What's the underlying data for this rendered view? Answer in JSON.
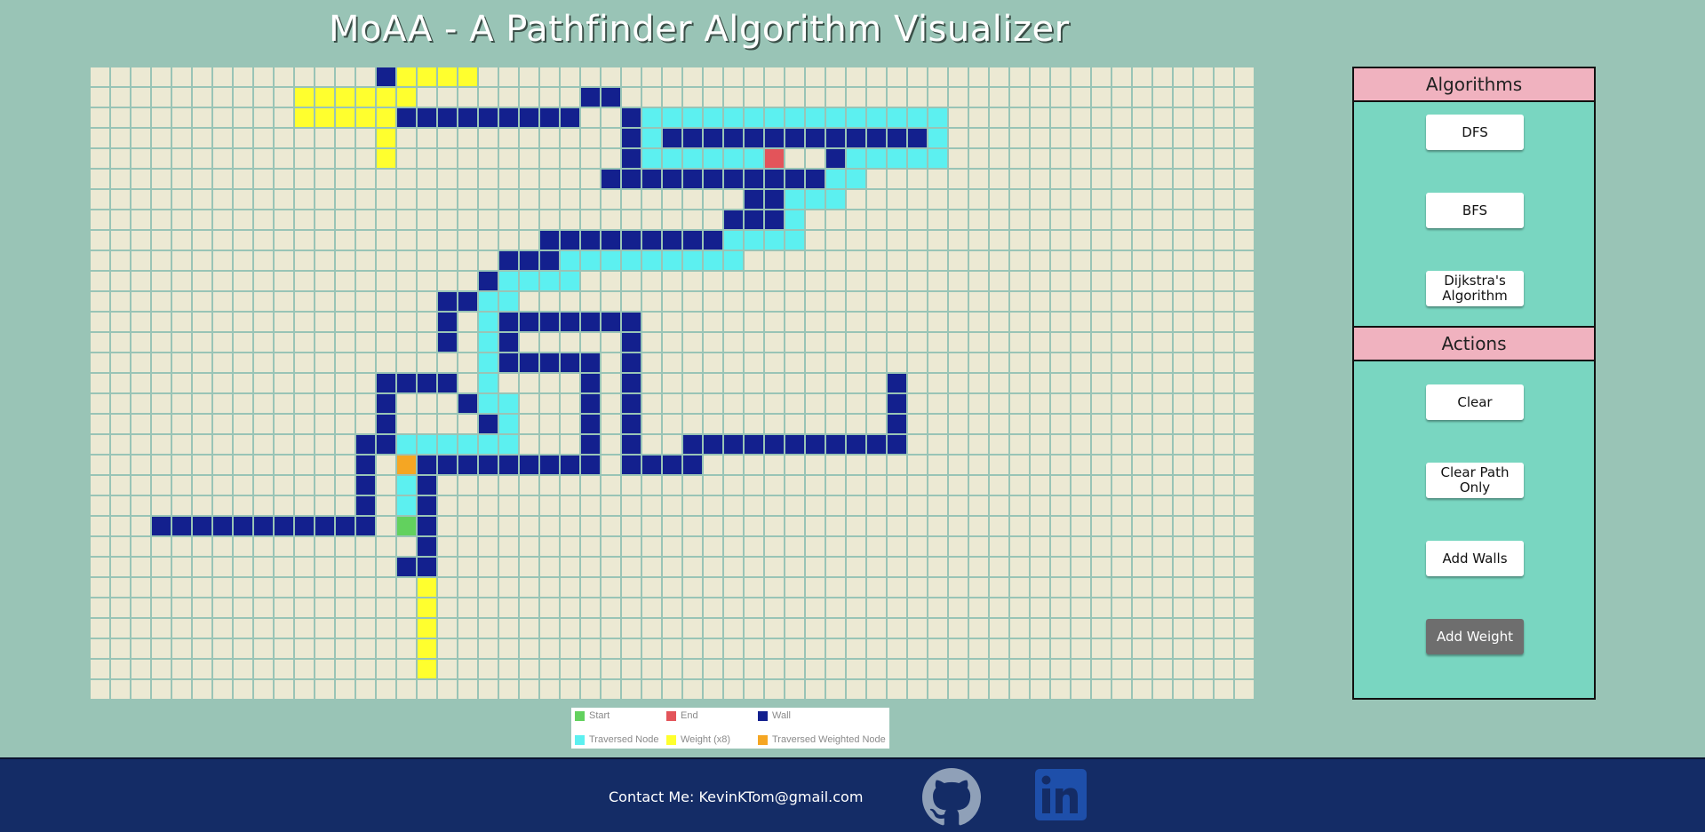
{
  "app": {
    "title": "MoAA - A Pathfinder Algorithm Visualizer"
  },
  "grid": {
    "rows": [
      ".....................................................",
      "...........................",
      "...........................................................",
      "...........................................................",
      "...........................................................",
      "...........................................................",
      "...........................................................",
      "...........................................................",
      "...........................................................",
      "...........................................................",
      "...........................................................",
      "...........................................................",
      "...........................................................",
      "...........................................................",
      "...........................................................",
      "...........................................................",
      "...........................................................",
      "...........................................................",
      "...........................................................",
      "...........................................................",
      "...........................................................",
      "...........................................................",
      "...........................................................",
      "...........................................................",
      "...........................................................",
      "...........................................................",
      "...........................................................",
      "...........................................................",
      "...........................................................",
      "...........................................................",
      "..........................................................."
    ],
    "cells": [
      [
        0,
        14,
        "w"
      ],
      [
        0,
        15,
        "y"
      ],
      [
        0,
        16,
        "y"
      ],
      [
        0,
        17,
        "y"
      ],
      [
        0,
        18,
        "y"
      ],
      [
        1,
        10,
        "y"
      ],
      [
        1,
        11,
        "y"
      ],
      [
        1,
        12,
        "y"
      ],
      [
        1,
        13,
        "y"
      ],
      [
        1,
        14,
        "y"
      ],
      [
        1,
        15,
        "y"
      ],
      [
        1,
        24,
        "w"
      ],
      [
        1,
        25,
        "w"
      ],
      [
        2,
        10,
        "y"
      ],
      [
        2,
        11,
        "y"
      ],
      [
        2,
        12,
        "y"
      ],
      [
        2,
        13,
        "y"
      ],
      [
        2,
        14,
        "y"
      ],
      [
        2,
        15,
        "w"
      ],
      [
        2,
        16,
        "w"
      ],
      [
        2,
        17,
        "w"
      ],
      [
        2,
        18,
        "w"
      ],
      [
        2,
        19,
        "w"
      ],
      [
        2,
        20,
        "w"
      ],
      [
        2,
        21,
        "w"
      ],
      [
        2,
        22,
        "w"
      ],
      [
        2,
        23,
        "w"
      ],
      [
        2,
        26,
        "w"
      ],
      [
        2,
        27,
        "t"
      ],
      [
        2,
        28,
        "t"
      ],
      [
        2,
        29,
        "t"
      ],
      [
        2,
        30,
        "t"
      ],
      [
        2,
        31,
        "t"
      ],
      [
        2,
        32,
        "t"
      ],
      [
        2,
        33,
        "t"
      ],
      [
        2,
        34,
        "t"
      ],
      [
        2,
        35,
        "t"
      ],
      [
        2,
        36,
        "t"
      ],
      [
        2,
        37,
        "t"
      ],
      [
        2,
        38,
        "t"
      ],
      [
        2,
        39,
        "t"
      ],
      [
        2,
        40,
        "t"
      ],
      [
        2,
        41,
        "t"
      ],
      [
        3,
        14,
        "y"
      ],
      [
        3,
        26,
        "w"
      ],
      [
        3,
        27,
        "t"
      ],
      [
        3,
        28,
        "w"
      ],
      [
        3,
        29,
        "w"
      ],
      [
        3,
        30,
        "w"
      ],
      [
        3,
        31,
        "w"
      ],
      [
        3,
        32,
        "w"
      ],
      [
        3,
        33,
        "w"
      ],
      [
        3,
        34,
        "w"
      ],
      [
        3,
        35,
        "w"
      ],
      [
        3,
        36,
        "w"
      ],
      [
        3,
        37,
        "w"
      ],
      [
        3,
        38,
        "w"
      ],
      [
        3,
        39,
        "w"
      ],
      [
        3,
        40,
        "w"
      ],
      [
        3,
        41,
        "t"
      ],
      [
        4,
        14,
        "y"
      ],
      [
        4,
        26,
        "w"
      ],
      [
        4,
        27,
        "t"
      ],
      [
        4,
        28,
        "t"
      ],
      [
        4,
        29,
        "t"
      ],
      [
        4,
        30,
        "t"
      ],
      [
        4,
        31,
        "t"
      ],
      [
        4,
        32,
        "t"
      ],
      [
        4,
        33,
        "e"
      ],
      [
        4,
        36,
        "w"
      ],
      [
        4,
        37,
        "t"
      ],
      [
        4,
        38,
        "t"
      ],
      [
        4,
        39,
        "t"
      ],
      [
        4,
        40,
        "t"
      ],
      [
        4,
        41,
        "t"
      ],
      [
        5,
        25,
        "w"
      ],
      [
        5,
        26,
        "w"
      ],
      [
        5,
        27,
        "w"
      ],
      [
        5,
        28,
        "w"
      ],
      [
        5,
        29,
        "w"
      ],
      [
        5,
        30,
        "w"
      ],
      [
        5,
        31,
        "w"
      ],
      [
        5,
        32,
        "w"
      ],
      [
        5,
        33,
        "w"
      ],
      [
        5,
        34,
        "w"
      ],
      [
        5,
        35,
        "w"
      ],
      [
        5,
        36,
        "t"
      ],
      [
        5,
        37,
        "t"
      ],
      [
        6,
        32,
        "w"
      ],
      [
        6,
        33,
        "w"
      ],
      [
        6,
        34,
        "t"
      ],
      [
        6,
        35,
        "t"
      ],
      [
        6,
        36,
        "t"
      ],
      [
        7,
        31,
        "w"
      ],
      [
        7,
        32,
        "w"
      ],
      [
        7,
        33,
        "w"
      ],
      [
        7,
        34,
        "t"
      ],
      [
        8,
        22,
        "w"
      ],
      [
        8,
        23,
        "w"
      ],
      [
        8,
        24,
        "w"
      ],
      [
        8,
        25,
        "w"
      ],
      [
        8,
        26,
        "w"
      ],
      [
        8,
        27,
        "w"
      ],
      [
        8,
        28,
        "w"
      ],
      [
        8,
        29,
        "w"
      ],
      [
        8,
        30,
        "w"
      ],
      [
        8,
        31,
        "t"
      ],
      [
        8,
        32,
        "t"
      ],
      [
        8,
        33,
        "t"
      ],
      [
        8,
        34,
        "t"
      ],
      [
        9,
        20,
        "w"
      ],
      [
        9,
        21,
        "w"
      ],
      [
        9,
        22,
        "w"
      ],
      [
        9,
        23,
        "t"
      ],
      [
        9,
        24,
        "t"
      ],
      [
        9,
        25,
        "t"
      ],
      [
        9,
        26,
        "t"
      ],
      [
        9,
        27,
        "t"
      ],
      [
        9,
        28,
        "t"
      ],
      [
        9,
        29,
        "t"
      ],
      [
        9,
        30,
        "t"
      ],
      [
        9,
        31,
        "t"
      ],
      [
        10,
        19,
        "w"
      ],
      [
        10,
        20,
        "t"
      ],
      [
        10,
        21,
        "t"
      ],
      [
        10,
        22,
        "t"
      ],
      [
        10,
        23,
        "t"
      ],
      [
        11,
        17,
        "w"
      ],
      [
        11,
        18,
        "w"
      ],
      [
        11,
        19,
        "t"
      ],
      [
        11,
        20,
        "t"
      ],
      [
        12,
        17,
        "w"
      ],
      [
        12,
        19,
        "t"
      ],
      [
        12,
        20,
        "w"
      ],
      [
        12,
        21,
        "w"
      ],
      [
        12,
        22,
        "w"
      ],
      [
        12,
        23,
        "w"
      ],
      [
        12,
        24,
        "w"
      ],
      [
        12,
        25,
        "w"
      ],
      [
        12,
        26,
        "w"
      ],
      [
        13,
        17,
        "w"
      ],
      [
        13,
        19,
        "t"
      ],
      [
        13,
        20,
        "w"
      ],
      [
        13,
        26,
        "w"
      ],
      [
        14,
        19,
        "t"
      ],
      [
        14,
        20,
        "w"
      ],
      [
        14,
        21,
        "w"
      ],
      [
        14,
        22,
        "w"
      ],
      [
        14,
        23,
        "w"
      ],
      [
        14,
        24,
        "w"
      ],
      [
        14,
        26,
        "w"
      ],
      [
        15,
        14,
        "w"
      ],
      [
        15,
        15,
        "w"
      ],
      [
        15,
        16,
        "w"
      ],
      [
        15,
        17,
        "w"
      ],
      [
        15,
        19,
        "t"
      ],
      [
        15,
        24,
        "w"
      ],
      [
        15,
        26,
        "w"
      ],
      [
        15,
        39,
        "w"
      ],
      [
        16,
        14,
        "w"
      ],
      [
        16,
        18,
        "w"
      ],
      [
        16,
        19,
        "t"
      ],
      [
        16,
        20,
        "t"
      ],
      [
        16,
        24,
        "w"
      ],
      [
        16,
        26,
        "w"
      ],
      [
        16,
        39,
        "w"
      ],
      [
        17,
        14,
        "w"
      ],
      [
        17,
        19,
        "w"
      ],
      [
        17,
        20,
        "t"
      ],
      [
        17,
        24,
        "w"
      ],
      [
        17,
        26,
        "w"
      ],
      [
        17,
        39,
        "w"
      ],
      [
        18,
        13,
        "w"
      ],
      [
        18,
        14,
        "w"
      ],
      [
        18,
        15,
        "t"
      ],
      [
        18,
        16,
        "t"
      ],
      [
        18,
        17,
        "t"
      ],
      [
        18,
        18,
        "t"
      ],
      [
        18,
        19,
        "t"
      ],
      [
        18,
        20,
        "t"
      ],
      [
        18,
        24,
        "w"
      ],
      [
        18,
        26,
        "w"
      ],
      [
        18,
        29,
        "w"
      ],
      [
        18,
        30,
        "w"
      ],
      [
        18,
        31,
        "w"
      ],
      [
        18,
        32,
        "w"
      ],
      [
        18,
        33,
        "w"
      ],
      [
        18,
        34,
        "w"
      ],
      [
        18,
        35,
        "w"
      ],
      [
        18,
        36,
        "w"
      ],
      [
        18,
        37,
        "w"
      ],
      [
        18,
        38,
        "w"
      ],
      [
        18,
        39,
        "w"
      ],
      [
        19,
        13,
        "w"
      ],
      [
        19,
        15,
        "o"
      ],
      [
        19,
        16,
        "w"
      ],
      [
        19,
        17,
        "w"
      ],
      [
        19,
        18,
        "w"
      ],
      [
        19,
        19,
        "w"
      ],
      [
        19,
        20,
        "w"
      ],
      [
        19,
        21,
        "w"
      ],
      [
        19,
        22,
        "w"
      ],
      [
        19,
        23,
        "w"
      ],
      [
        19,
        24,
        "w"
      ],
      [
        19,
        26,
        "w"
      ],
      [
        19,
        27,
        "w"
      ],
      [
        19,
        28,
        "w"
      ],
      [
        19,
        29,
        "w"
      ],
      [
        20,
        13,
        "w"
      ],
      [
        20,
        15,
        "t"
      ],
      [
        20,
        16,
        "w"
      ],
      [
        21,
        13,
        "w"
      ],
      [
        21,
        15,
        "t"
      ],
      [
        21,
        16,
        "w"
      ],
      [
        22,
        3,
        "w"
      ],
      [
        22,
        4,
        "w"
      ],
      [
        22,
        5,
        "w"
      ],
      [
        22,
        6,
        "w"
      ],
      [
        22,
        7,
        "w"
      ],
      [
        22,
        8,
        "w"
      ],
      [
        22,
        9,
        "w"
      ],
      [
        22,
        10,
        "w"
      ],
      [
        22,
        11,
        "w"
      ],
      [
        22,
        12,
        "w"
      ],
      [
        22,
        13,
        "w"
      ],
      [
        22,
        15,
        "s"
      ],
      [
        22,
        16,
        "w"
      ],
      [
        23,
        16,
        "w"
      ],
      [
        24,
        15,
        "w"
      ],
      [
        24,
        16,
        "w"
      ],
      [
        25,
        16,
        "y"
      ],
      [
        26,
        16,
        "y"
      ],
      [
        27,
        16,
        "y"
      ],
      [
        28,
        16,
        "y"
      ],
      [
        29,
        16,
        "y"
      ]
    ]
  },
  "legend": {
    "start": "Start",
    "end": "End",
    "wall": "Wall",
    "traversed": "Traversed Node",
    "weight": "Weight (x8)",
    "traversed_weighted": "Traversed Weighted Node"
  },
  "colors": {
    "start": "#62d15e",
    "end": "#e3545a",
    "wall": "#13208e",
    "traversed": "#5cf0f0",
    "weight": "#ffff2e",
    "traversed_weighted": "#f5a623"
  },
  "panel": {
    "algorithms_header": "Algorithms",
    "dfs": "DFS",
    "bfs": "BFS",
    "dijkstra": "Dijkstra's Algorithm",
    "actions_header": "Actions",
    "clear": "Clear",
    "clear_path": "Clear Path Only",
    "add_walls": "Add Walls",
    "add_weight": "Add Weight"
  },
  "footer": {
    "contact": "Contact Me: KevinKTom@gmail.com",
    "github_icon": "github-icon",
    "linkedin_icon": "linkedin-icon"
  }
}
